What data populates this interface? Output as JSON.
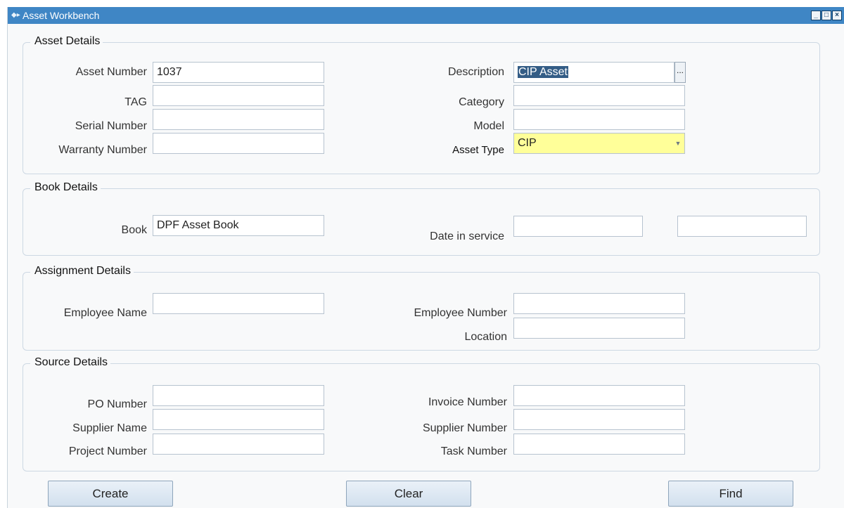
{
  "window": {
    "title": "Asset Workbench",
    "controls": {
      "minimize": "_",
      "maximize": "□",
      "close": "×"
    }
  },
  "sections": {
    "asset_details": {
      "title": "Asset Details",
      "asset_number": {
        "label": "Asset Number",
        "value": "1037"
      },
      "tag": {
        "label": "TAG",
        "value": ""
      },
      "serial_number": {
        "label": "Serial Number",
        "value": ""
      },
      "warranty_number": {
        "label": "Warranty Number",
        "value": ""
      },
      "description": {
        "label": "Description",
        "value": "CIP Asset",
        "lov_button": "..."
      },
      "category": {
        "label": "Category",
        "value": ""
      },
      "model": {
        "label": "Model",
        "value": ""
      },
      "asset_type": {
        "label": "Asset Type",
        "value": "CIP",
        "arrow": "▼"
      }
    },
    "book_details": {
      "title": "Book Details",
      "book": {
        "label": "Book",
        "value": "DPF Asset Book"
      },
      "date_in_service": {
        "label": "Date in service",
        "value": "",
        "value2": ""
      }
    },
    "assignment_details": {
      "title": "Assignment Details",
      "employee_name": {
        "label": "Employee Name",
        "value": ""
      },
      "employee_number": {
        "label": "Employee Number",
        "value": ""
      },
      "location": {
        "label": "Location",
        "value": ""
      }
    },
    "source_details": {
      "title": "Source Details",
      "po_number": {
        "label": "PO Number",
        "value": ""
      },
      "supplier_name": {
        "label": "Supplier Name",
        "value": ""
      },
      "project_number": {
        "label": "Project Number",
        "value": ""
      },
      "invoice_number": {
        "label": "Invoice Number",
        "value": ""
      },
      "supplier_number": {
        "label": "Supplier Number",
        "value": ""
      },
      "task_number": {
        "label": "Task Number",
        "value": ""
      }
    }
  },
  "buttons": {
    "create": "Create",
    "clear": "Clear",
    "find": "Find"
  },
  "colors": {
    "titlebar": "#3f86c5",
    "required_field": "#ffff99",
    "selection": "#345d86",
    "button_bg": "#dae6f2"
  }
}
